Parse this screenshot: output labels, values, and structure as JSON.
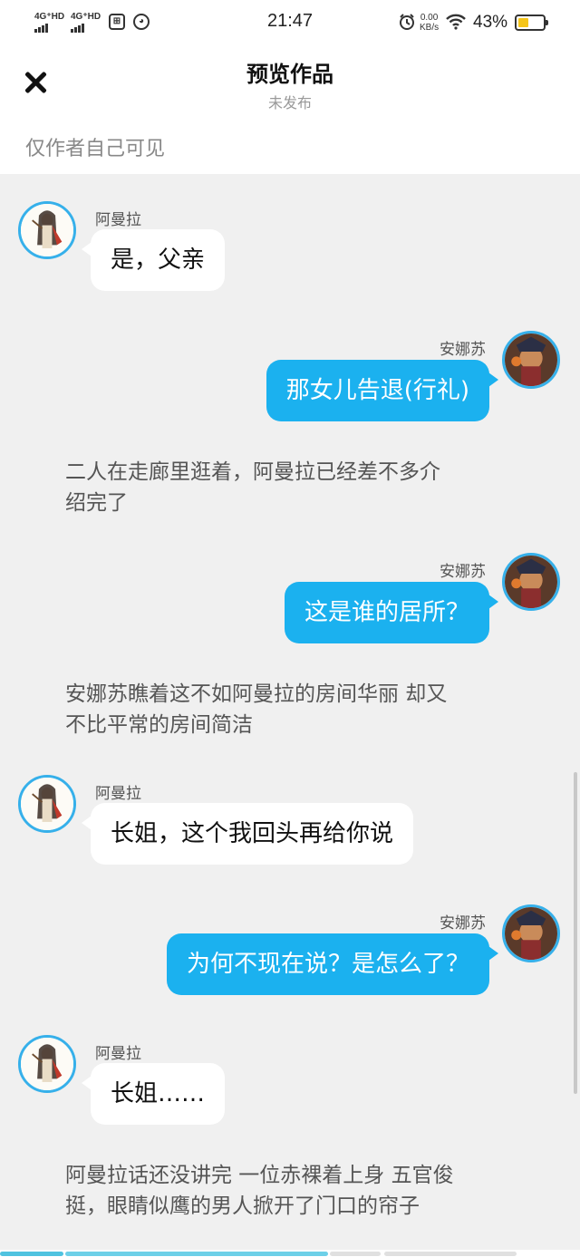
{
  "status_bar": {
    "network1": "4G⁺HD",
    "network2": "4G⁺HD",
    "time": "21:47",
    "speed_value": "0.00",
    "speed_unit": "KB/s",
    "battery_pct": "43%",
    "battery_level": 0.43,
    "icons": [
      "signal-icon",
      "signal-icon",
      "app-notification-icon",
      "cat-notification-icon",
      "alarm-icon",
      "wifi-icon",
      "battery-icon"
    ]
  },
  "header": {
    "title": "预览作品",
    "subtitle": "未发布",
    "visibility_note": "仅作者自己可见"
  },
  "colors": {
    "accent": "#1bb1ef",
    "avatar_ring": "#36b0ea",
    "background": "#f0f0f0"
  },
  "messages": [
    {
      "type": "left",
      "name": "阿曼拉",
      "text": "是，父亲"
    },
    {
      "type": "right",
      "name": "安娜苏",
      "text": "那女儿告退(行礼)"
    },
    {
      "type": "narration",
      "lines": [
        "二人在走廊里逛着，阿曼拉已经差不多介",
        "绍完了"
      ]
    },
    {
      "type": "right",
      "name": "安娜苏",
      "text": "这是谁的居所？"
    },
    {
      "type": "narration",
      "lines": [
        "安娜苏瞧着这不如阿曼拉的房间华丽 却又",
        "不比平常的房间简洁"
      ]
    },
    {
      "type": "left",
      "name": "阿曼拉",
      "text": "长姐，这个我回头再给你说"
    },
    {
      "type": "right",
      "name": "安娜苏",
      "text": "为何不现在说？是怎么了？"
    },
    {
      "type": "left",
      "name": "阿曼拉",
      "text": "长姐……"
    },
    {
      "type": "narration",
      "lines": [
        "阿曼拉话还没讲完 一位赤裸着上身 五官俊",
        "挺，眼睛似鹰的男人掀开了门口的帘子"
      ]
    }
  ]
}
